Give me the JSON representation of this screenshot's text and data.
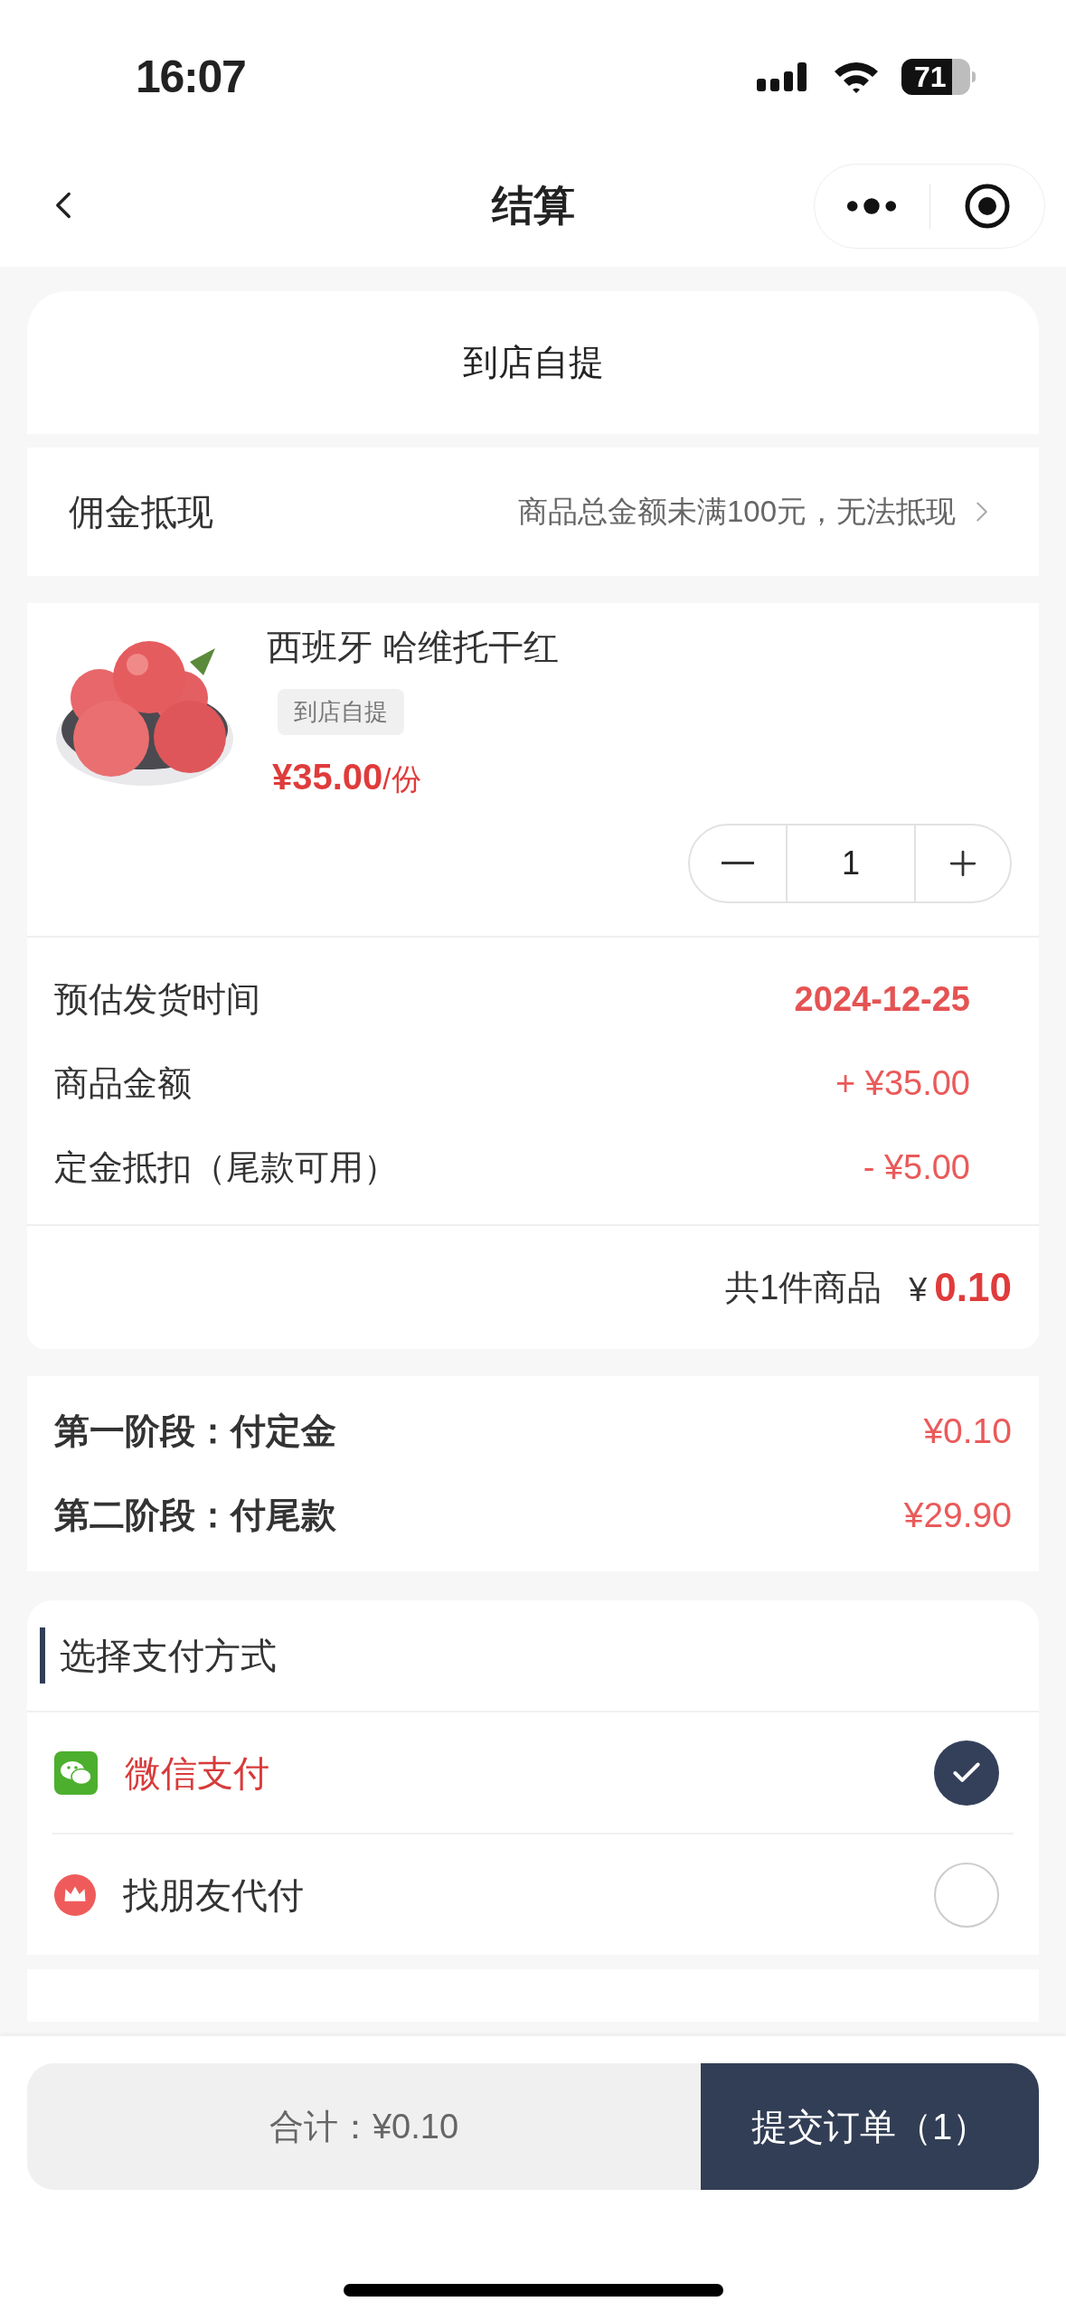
{
  "status_bar": {
    "time": "16:07",
    "battery": "71"
  },
  "nav": {
    "title": "结算"
  },
  "delivery": {
    "label": "到店自提"
  },
  "commission": {
    "label": "佣金抵现",
    "note": "商品总金额未满100元，无法抵现"
  },
  "product": {
    "kind": "picture",
    "name": "西班牙 哈维托干红",
    "tag": "到店自提",
    "price": "¥35.00",
    "unit": "/份",
    "quantity": "1"
  },
  "details": [
    {
      "label": "预估发货时间",
      "value": "2024-12-25",
      "kind": "date"
    },
    {
      "label": "商品金额",
      "value": "+ ¥35.00",
      "kind": "amount"
    },
    {
      "label": "定金抵扣（尾款可用）",
      "value": "- ¥5.00",
      "kind": "amount"
    }
  ],
  "summary": {
    "count": "共1件商品",
    "currency": "¥",
    "total": "0.10"
  },
  "stages": [
    {
      "label": "第一阶段：付定金",
      "amount": "¥0.10"
    },
    {
      "label": "第二阶段：付尾款",
      "amount": "¥29.90"
    }
  ],
  "payment": {
    "title": "选择支付方式",
    "methods": [
      {
        "label": "微信支付",
        "kind": "wechat",
        "selected": true
      },
      {
        "label": "找朋友代付",
        "kind": "friend",
        "selected": false
      }
    ]
  },
  "footer": {
    "total_label": "合计：",
    "total": "¥0.10",
    "submit": "提交订单（1）"
  }
}
